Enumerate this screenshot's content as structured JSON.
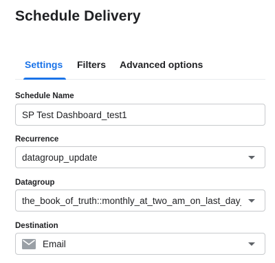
{
  "dialog": {
    "title": "Schedule Delivery"
  },
  "tabs": [
    {
      "label": "Settings",
      "active": true
    },
    {
      "label": "Filters",
      "active": false
    },
    {
      "label": "Advanced options",
      "active": false
    }
  ],
  "form": {
    "schedule_name": {
      "label": "Schedule Name",
      "value": "SP Test Dashboard_test1"
    },
    "recurrence": {
      "label": "Recurrence",
      "value": "datagroup_update"
    },
    "datagroup": {
      "label": "Datagroup",
      "value": "the_book_of_truth::monthly_at_two_am_on_last_day_test_"
    },
    "destination": {
      "label": "Destination",
      "value": "Email",
      "icon": "mail-icon"
    }
  },
  "colors": {
    "accent": "#1a73e8",
    "text": "#202124",
    "border": "#c7c9cc",
    "icon": "#9aa0a6"
  }
}
